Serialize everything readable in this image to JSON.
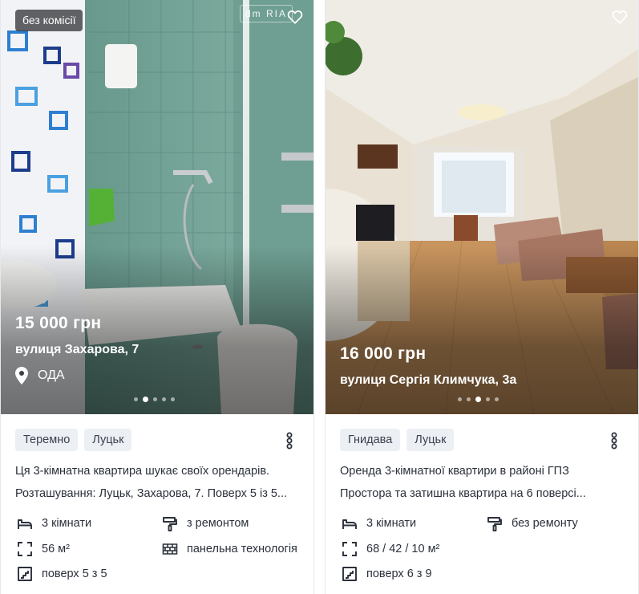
{
  "listings": [
    {
      "badge": "без комісії",
      "watermark": "dm RIA",
      "price": "15 000 грн",
      "address": "вулиця Захарова, 7",
      "district": "ОДА",
      "photo_index": 2,
      "photo_total": 5,
      "tags": [
        "Теремно",
        "Луцьк"
      ],
      "description": [
        "Ця 3-кімнатна квартира шукає своїх орендарів.",
        "Розташування: Луцьк, Захарова, 7. Поверх 5 із 5..."
      ],
      "features": {
        "rooms": "3 кімнати",
        "repair": "з ремонтом",
        "area": "56 м²",
        "building": "панельна технологія",
        "floor": "поверх 5 з 5"
      }
    },
    {
      "price": "16 000 грн",
      "address": "вулиця Сергія Климчука, 3а",
      "photo_index": 3,
      "photo_total": 5,
      "tags": [
        "Гнидава",
        "Луцьк"
      ],
      "description": [
        "Оренда 3-кімнатної квартири в районі ГПЗ",
        "Простора та затишна квартира на 6 поверсі..."
      ],
      "features": {
        "rooms": "3 кімнати",
        "repair": "без ремонту",
        "area": "68 / 42 / 10 м²",
        "floor": "поверх 6 з 9"
      }
    }
  ],
  "icons": {
    "favorite": "heart-icon",
    "location": "map-pin-icon",
    "menu": "more-vertical-icon",
    "rooms": "bed-icon",
    "repair": "paint-roller-icon",
    "area": "area-frame-icon",
    "building": "brick-wall-icon",
    "floor": "stairs-icon"
  },
  "colors": {
    "tag_bg": "#eceff3",
    "text": "#2b303b",
    "price_text": "#ffffff"
  }
}
